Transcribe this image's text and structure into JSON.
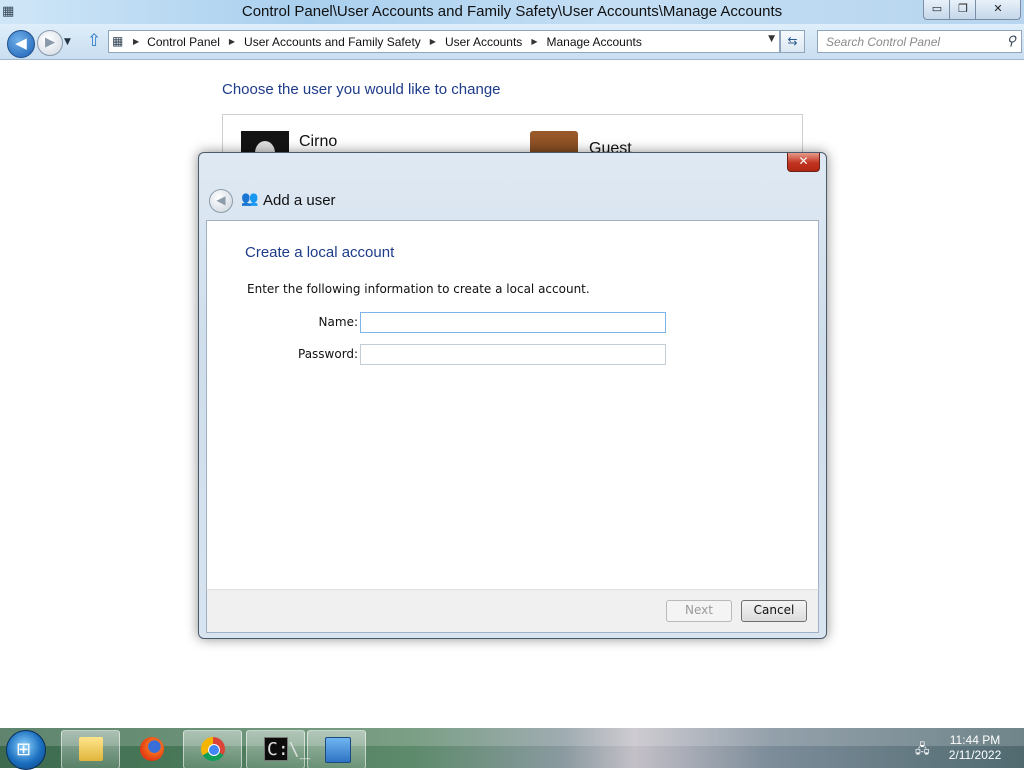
{
  "window": {
    "title": "Control Panel\\User Accounts and Family Safety\\User Accounts\\Manage Accounts",
    "minimize_glyph": "▭",
    "maximize_glyph": "❐",
    "close_glyph": "✕"
  },
  "navigation": {
    "back_icon": "back-arrow-icon",
    "forward_icon": "forward-arrow-icon",
    "breadcrumbs": [
      {
        "label": "Control Panel"
      },
      {
        "label": "User Accounts and Family Safety"
      },
      {
        "label": "User Accounts"
      },
      {
        "label": "Manage Accounts"
      }
    ],
    "search_placeholder": "Search Control Panel"
  },
  "manage_accounts": {
    "heading": "Choose the user you would like to change",
    "accounts": [
      {
        "name": "Cirno"
      },
      {
        "name": "Guest"
      }
    ]
  },
  "dialog": {
    "title": "Add a user",
    "close_glyph": "✕",
    "heading": "Create a local account",
    "instruction": "Enter the following information to create a local account.",
    "fields": {
      "name_label": "Name:",
      "name_value": "",
      "password_label": "Password:",
      "password_value": ""
    },
    "buttons": {
      "next": "Next",
      "cancel": "Cancel"
    }
  },
  "taskbar": {
    "apps": [
      "file-explorer",
      "firefox",
      "chrome",
      "command-prompt",
      "control-panel"
    ],
    "cmd_glyph": "C:\\_",
    "time": "11:44 PM",
    "date": "2/11/2022"
  },
  "colors": {
    "heading_blue": "#1e3b8a",
    "dialog_close_red": "#c2331f"
  }
}
